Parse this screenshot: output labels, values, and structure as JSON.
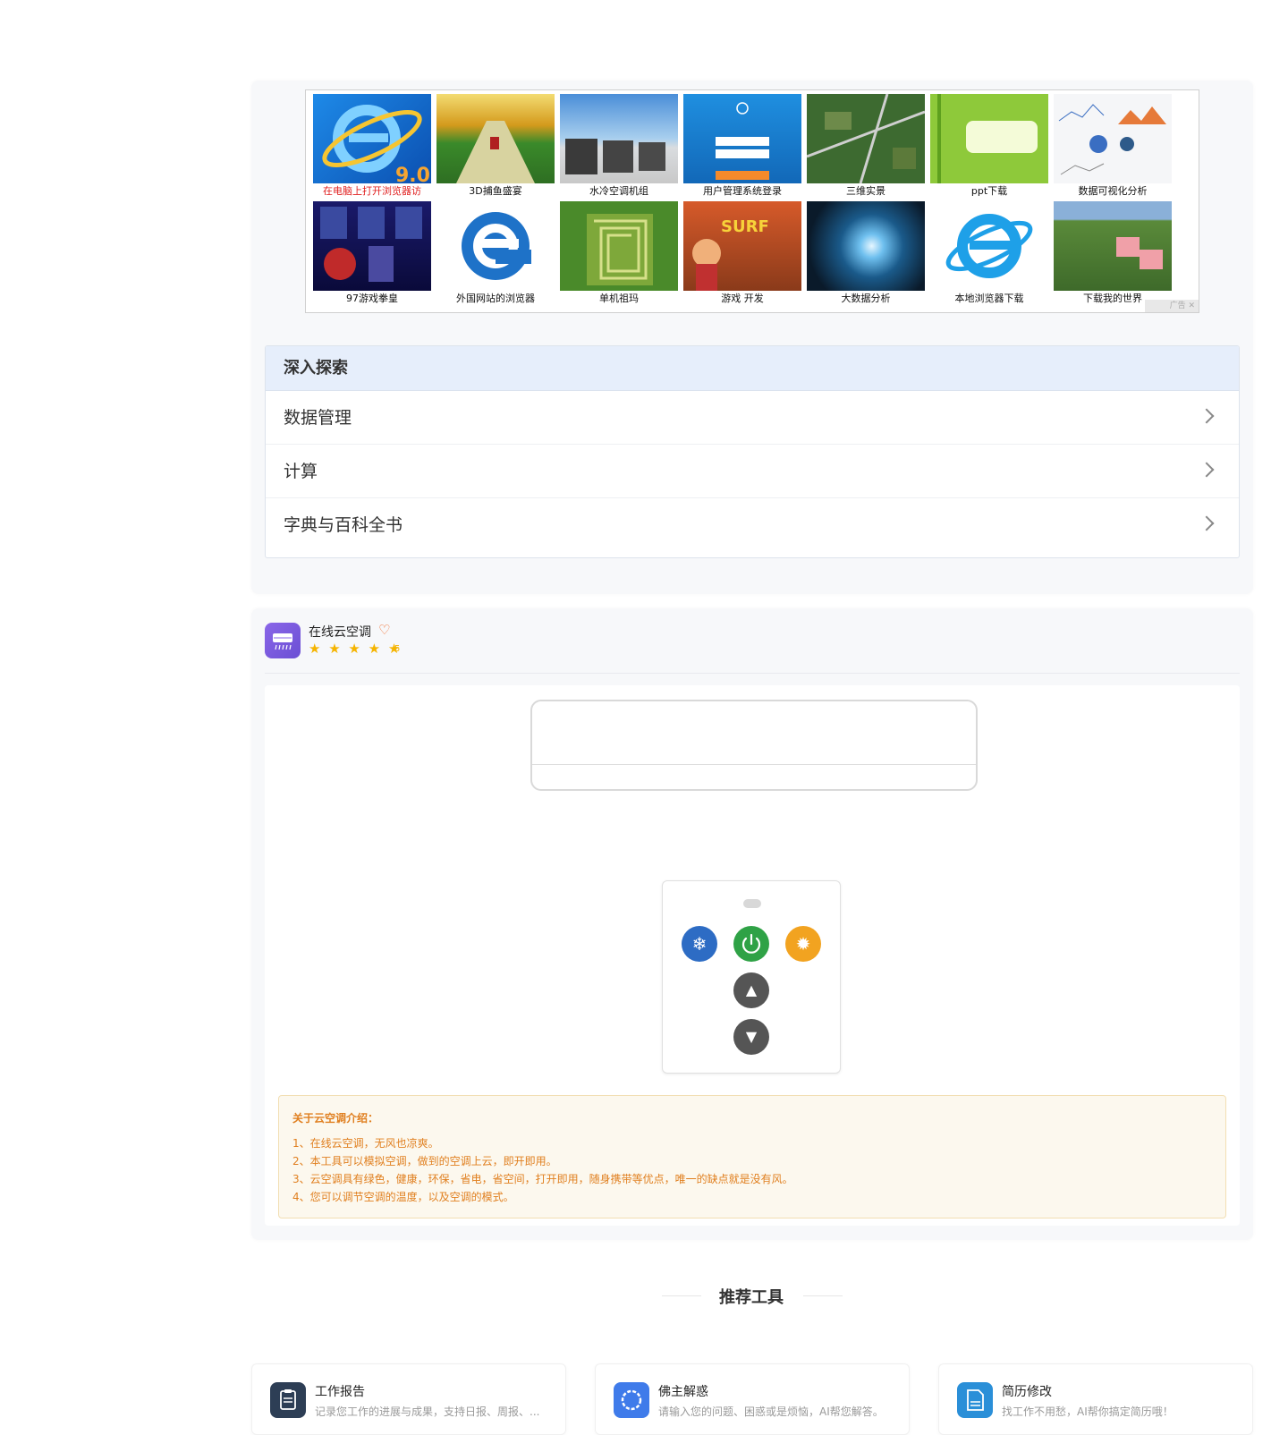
{
  "ads": {
    "tiles": [
      {
        "caption": "在电脑上打开浏览器访"
      },
      {
        "caption": "3D捕鱼盛宴"
      },
      {
        "caption": "水冷空调机组"
      },
      {
        "caption": "用户管理系统登录"
      },
      {
        "caption": "三维实景"
      },
      {
        "caption": "ppt下载"
      },
      {
        "caption": "数据可视化分析"
      },
      {
        "caption": "97游戏拳皇"
      },
      {
        "caption": "外国网站的浏览器"
      },
      {
        "caption": "单机祖玛"
      },
      {
        "caption": "游戏 开发"
      },
      {
        "caption": "大数据分析"
      },
      {
        "caption": "本地浏览器下载"
      },
      {
        "caption": "下载我的世界"
      }
    ],
    "tag": "广告 ✕"
  },
  "explore": {
    "title": "深入探索",
    "items": [
      {
        "label": "数据管理"
      },
      {
        "label": "计算"
      },
      {
        "label": "字典与百科全书"
      }
    ]
  },
  "tool": {
    "name": "在线云空调",
    "stars": "★ ★ ★ ★ ★",
    "rating": "5",
    "rating_value": 5,
    "remote": {
      "cold_icon": "snowflake-icon",
      "power_icon": "power-icon",
      "heat_icon": "sun-icon",
      "up_icon": "triangle-up-icon",
      "down_icon": "triangle-down-icon"
    },
    "intro": {
      "title": "关于云空调介绍：",
      "lines": [
        "1、在线云空调，无风也凉爽。",
        "2、本工具可以模拟空调，做到的空调上云，即开即用。",
        "3、云空调具有绿色，健康，环保，省电，省空间，打开即用，随身携带等优点，唯一的缺点就是没有风。",
        "4、您可以调节空调的温度，以及空调的模式。"
      ]
    }
  },
  "recommend": {
    "title": "推荐工具",
    "cards": [
      {
        "name": "工作报告",
        "desc": "记录您工作的进展与成果，支持日报、周报、...",
        "color": "#2d3e55"
      },
      {
        "name": "佛主解惑",
        "desc": "请输入您的问题、困惑或是烦恼，AI帮您解答。",
        "color": "#3f7bea"
      },
      {
        "name": "简历修改",
        "desc": "找工作不用愁，AI帮你搞定简历哦！",
        "color": "#2a8fd8"
      }
    ]
  }
}
